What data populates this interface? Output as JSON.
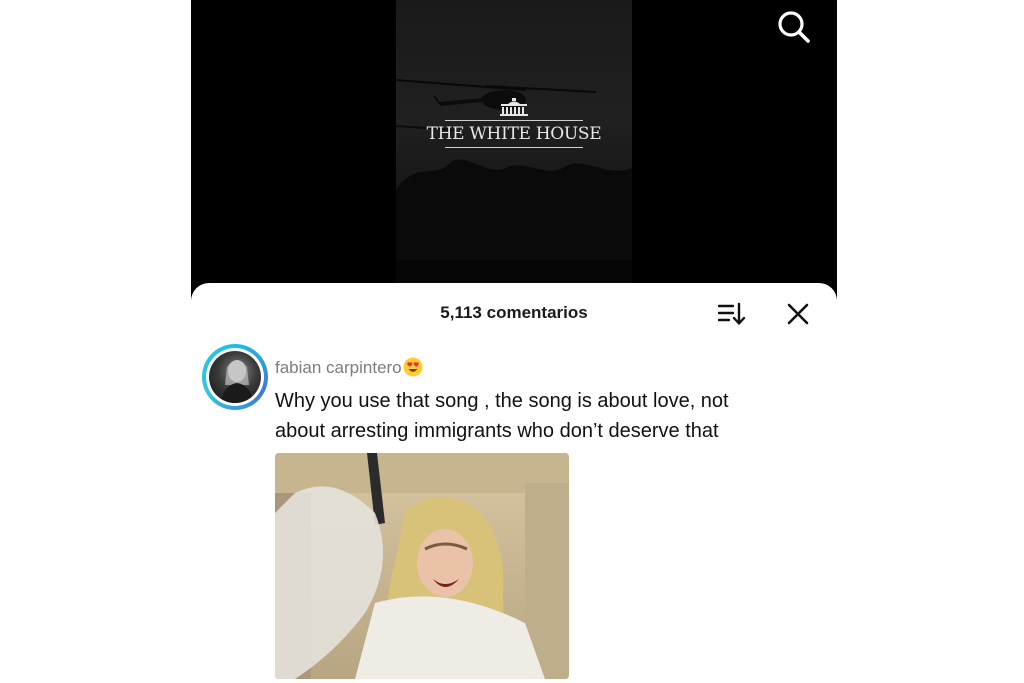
{
  "video": {
    "logo_text": "THE WHITE HOUSE",
    "icons": {
      "search": "search-icon"
    }
  },
  "comments_sheet": {
    "count_label": "5,113 comentarios",
    "icons": {
      "sort": "sort-icon",
      "close": "close-icon"
    }
  },
  "comment": {
    "username": "fabian carpintero",
    "username_emoji": "heart-eyes-emoji",
    "text_line1": "Why you use that song , the song is about love, not",
    "text_line2": "about arresting immigrants who don’t deserve that",
    "attachment": "gif-image"
  },
  "colors": {
    "ring": "#1ec0e6",
    "username": "#7d7d7d",
    "text": "#111111"
  }
}
